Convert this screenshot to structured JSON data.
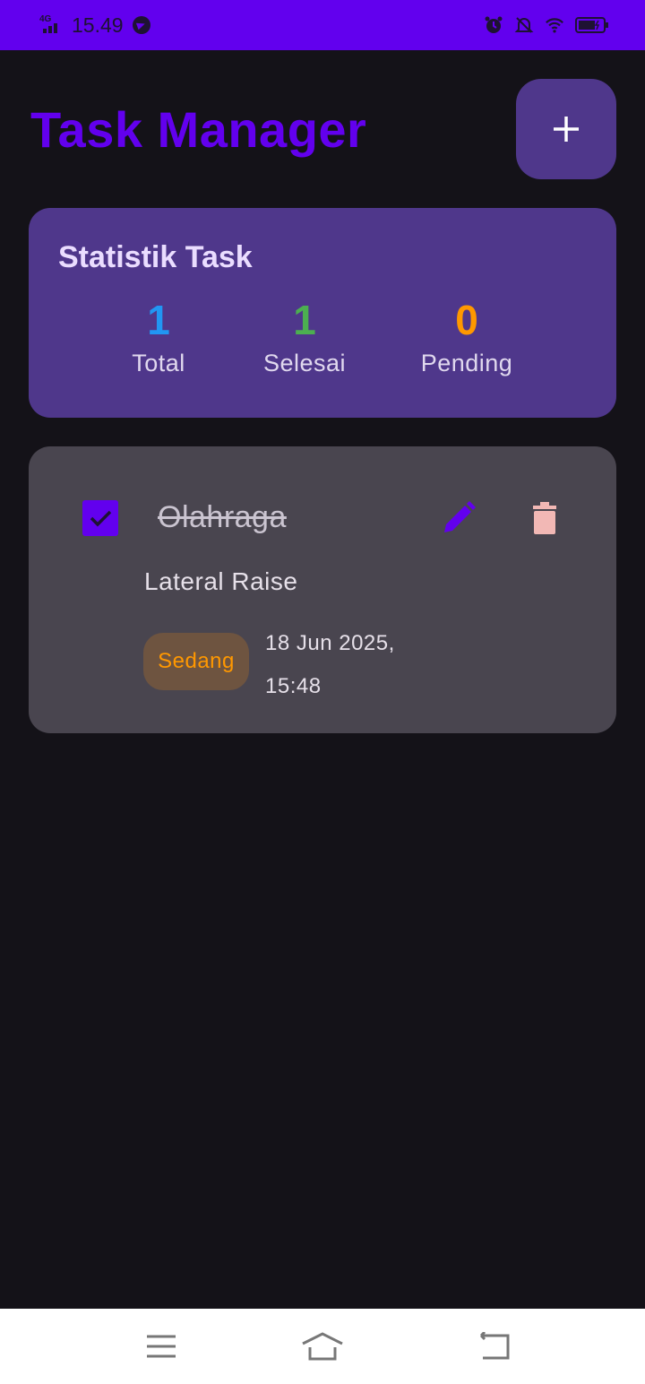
{
  "status_bar": {
    "network": "4G",
    "time": "15.49"
  },
  "header": {
    "title": "Task Manager",
    "add_icon": "plus-icon"
  },
  "stats": {
    "title": "Statistik Task",
    "total": {
      "value": "1",
      "label": "Total",
      "color": "#2196F3"
    },
    "done": {
      "value": "1",
      "label": "Selesai",
      "color": "#4CAF50"
    },
    "pending": {
      "value": "0",
      "label": "Pending",
      "color": "#FF9800"
    }
  },
  "tasks": [
    {
      "checked": true,
      "title": "Olahraga",
      "description": "Lateral Raise",
      "priority": "Sedang",
      "date_line1": "18 Jun 2025,",
      "date_line2": "15:48",
      "edit_icon": "pencil-icon",
      "delete_icon": "trash-icon"
    }
  ],
  "colors": {
    "accent": "#6200EE",
    "card": "#4F378B",
    "background": "#141218",
    "delete": "#F2B8B5"
  }
}
